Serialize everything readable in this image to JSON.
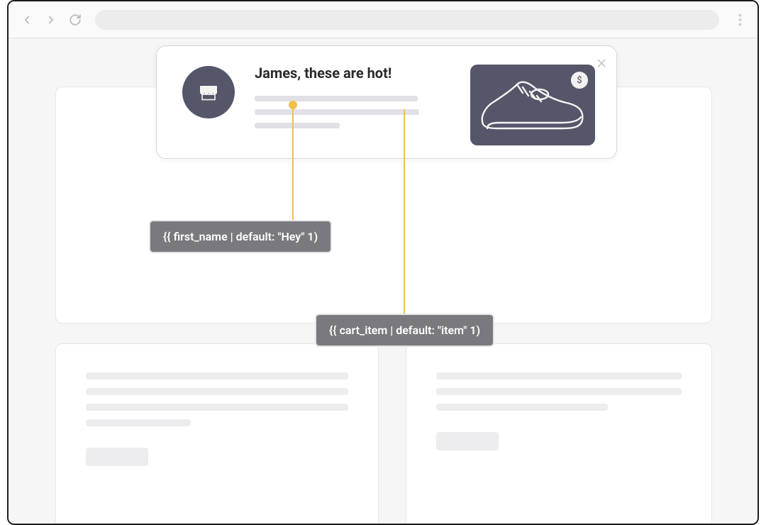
{
  "popup": {
    "title": "James, these are hot!",
    "price_symbol": "$"
  },
  "annotations": {
    "first_name": "{{ first_name | default: \"Hey\" 1)",
    "cart_item": "{{ cart_item | default: \"item\" 1)"
  }
}
